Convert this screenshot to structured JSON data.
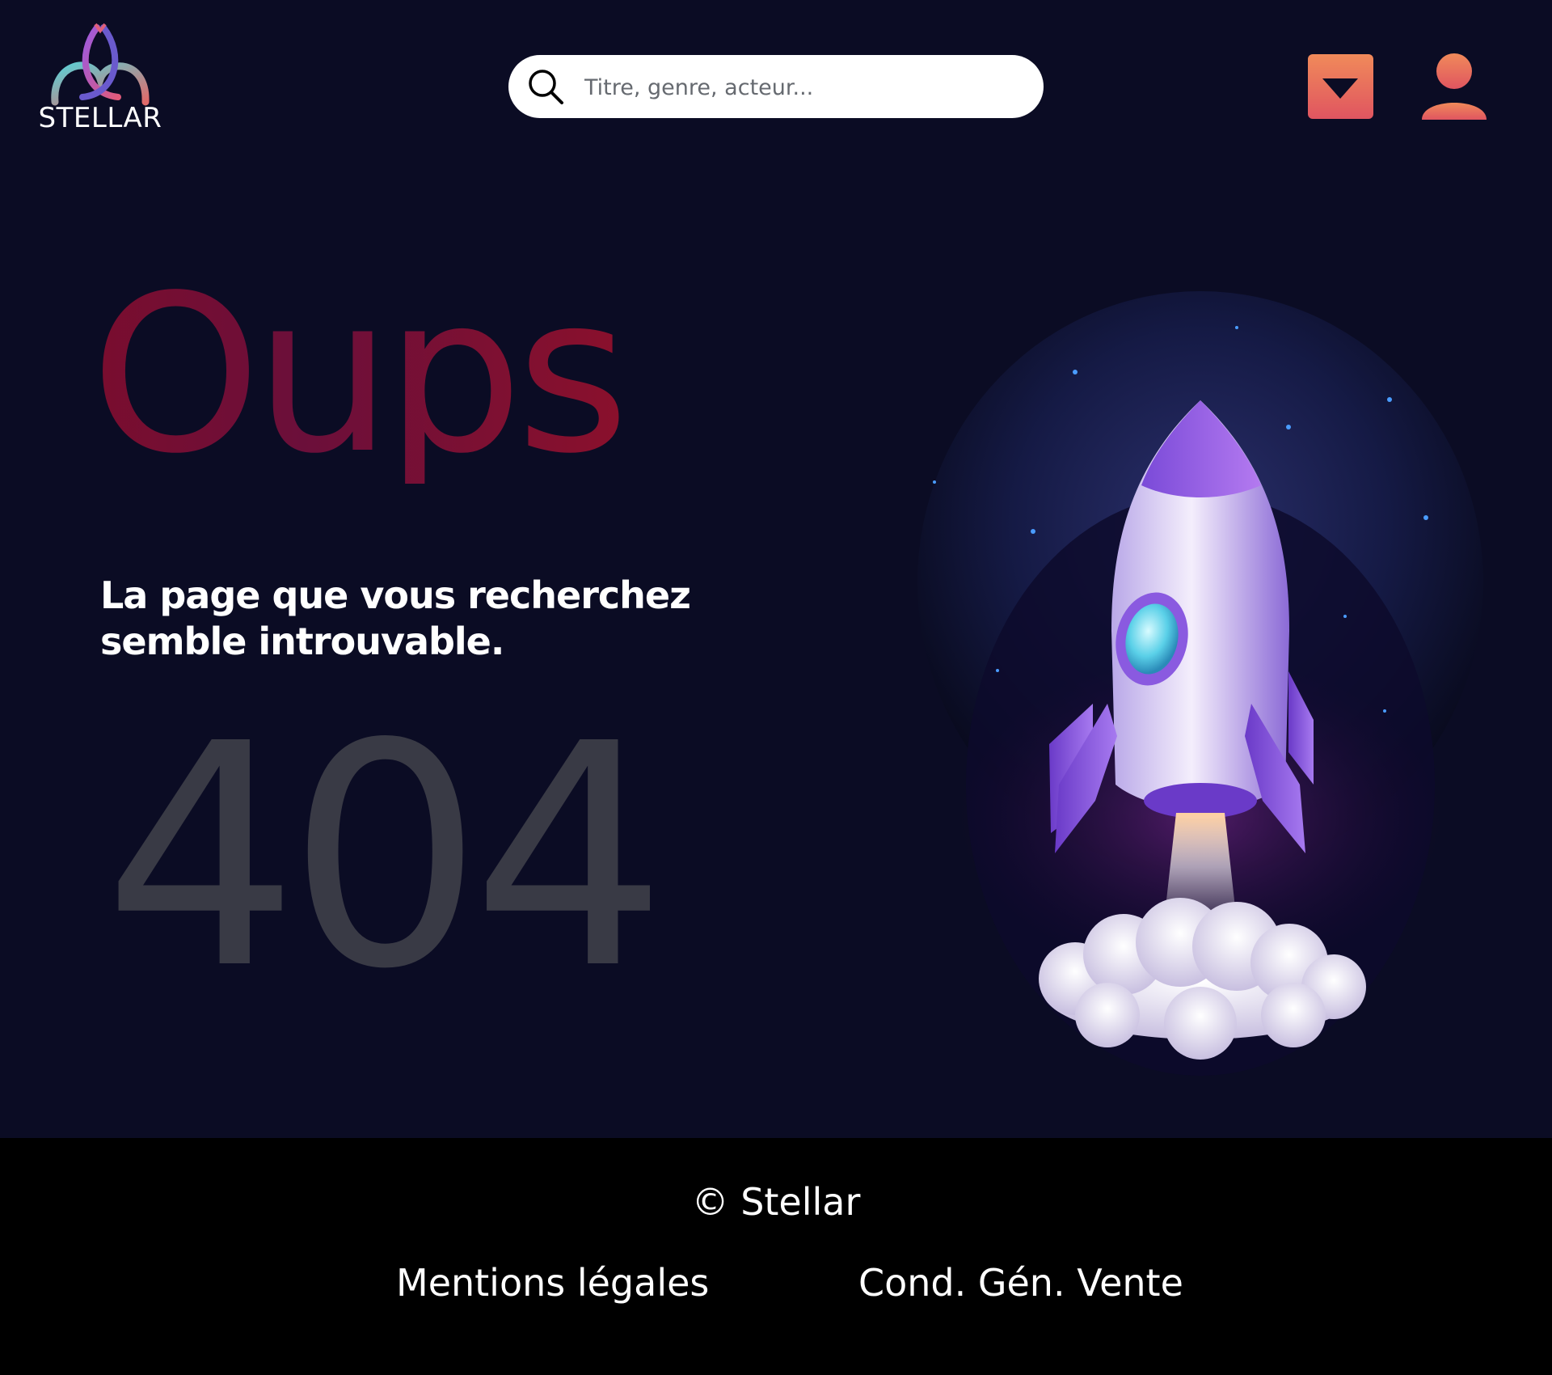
{
  "header": {
    "logo": {
      "text": "STELLAR",
      "icon": "stellar-logo-icon"
    },
    "search": {
      "placeholder": "Titre, genre, acteur...",
      "value": "",
      "icon": "search-icon"
    },
    "dropdown": {
      "icon": "caret-down-icon"
    },
    "user": {
      "icon": "user-icon"
    }
  },
  "main": {
    "title": "Oups",
    "subtitle": "La page que vous recherchez semble introuvable.",
    "error_code": "404",
    "illustration": "rocket-illustration"
  },
  "footer": {
    "copyright": "© Stellar",
    "links": [
      {
        "label": "Mentions légales"
      },
      {
        "label": "Cond. Gén. Vente"
      }
    ]
  },
  "colors": {
    "background": "#0b0c24",
    "footer_background": "#000000",
    "accent_gradient_start": "#f08a5a",
    "accent_gradient_end": "#e05560",
    "title_color": "#7a0d2e",
    "error_code_color": "#393a45",
    "rocket_purple": "#8a5ae0"
  }
}
